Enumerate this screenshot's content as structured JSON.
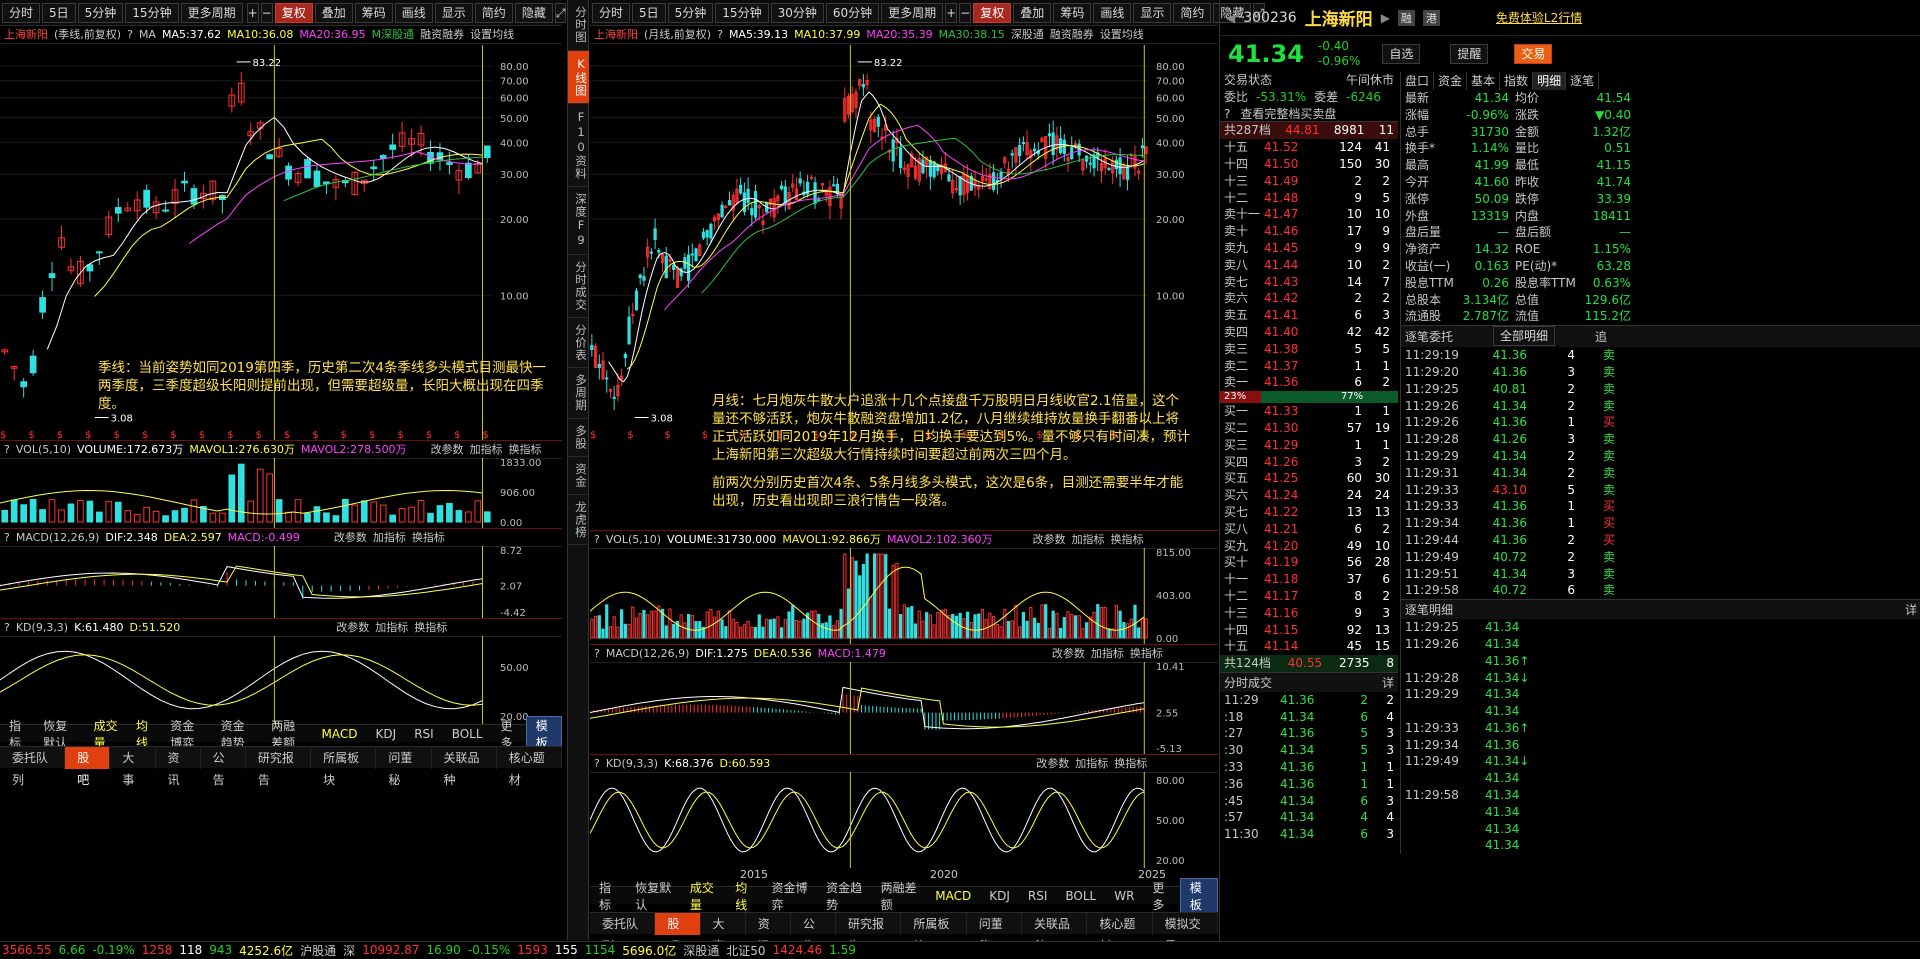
{
  "left_toolbar": {
    "periods": [
      "分时",
      "5日",
      "5分钟",
      "15分钟",
      "更多周期"
    ],
    "adj": "复权",
    "overlay": "叠加",
    "chips": "筹码",
    "draw": "画线",
    "display": "显示",
    "simple": "简约",
    "hide": "隐藏"
  },
  "right_toolbar": {
    "periods": [
      "分时",
      "5日",
      "5分钟",
      "15分钟",
      "30分钟",
      "60分钟",
      "更多周期"
    ],
    "adj": "复权",
    "overlay": "叠加",
    "chips": "筹码",
    "draw": "画线",
    "display": "显示",
    "simple": "简约",
    "hide": "隐藏"
  },
  "left_chart": {
    "header": {
      "name": "上海新阳",
      "mode": "(季线,前复权)",
      "ma_label": "MA",
      "ma5": "MA5:37.62",
      "ma10": "MA10:36.08",
      "ma20": "MA20:36.95",
      "ma30": "M深股通",
      "margin": "融资融券",
      "set": "设置均线"
    },
    "yticks": [
      "80.00",
      "70.00",
      "60.00",
      "50.00",
      "40.00",
      "30.00",
      "20.00",
      "10.00"
    ],
    "high_label": "83.22",
    "low_label": "3.08",
    "note": "季线：当前姿势如同2019第四季，历史第二次4条季线多头模式目测最快一两季度，三季度超级长阳则提前出现，但需要超级量，长阳大概出现在四季度。",
    "vol_header": {
      "name": "VOL(5,10)",
      "v": "VOLUME:172.673万",
      "m1": "MAVOL1:276.630万",
      "m2": "MAVOL2:278.500万",
      "edit": "改参数",
      "add": "加指标",
      "swap": "换指标"
    },
    "vol_ticks": [
      "1833.00",
      "906.00",
      "0.00"
    ],
    "macd_header": {
      "name": "MACD(12,26,9)",
      "dif": "DIF:2.348",
      "dea": "DEA:2.597",
      "macd": "MACD:-0.499",
      "edit": "改参数",
      "add": "加指标",
      "swap": "换指标"
    },
    "macd_ticks": [
      "8.72",
      "2.07",
      "-4.42"
    ],
    "kd_header": {
      "name": "KD(9,3,3)",
      "k": "K:61.480",
      "d": "D:51.520",
      "edit": "改参数",
      "add": "加指标",
      "swap": "换指标"
    },
    "kd_ticks": [
      "50.00",
      "20.00"
    ],
    "bottom_tabs": [
      "指标",
      "恢复默认",
      "成交量",
      "均线",
      "资金博弈",
      "资金趋势",
      "两融差额",
      "MACD",
      "KDJ",
      "RSI",
      "BOLL",
      "更多",
      "模板"
    ]
  },
  "vtabs": [
    "分时图",
    "K线图",
    "F10资料",
    "深度F9",
    "分时成交",
    "分价表",
    "多周期",
    "多股",
    "资金",
    "龙虎榜"
  ],
  "right_chart": {
    "header": {
      "name": "上海新阳",
      "mode": "(月线,前复权)",
      "ma5": "MA5:39.13",
      "ma10": "MA10:37.99",
      "ma20": "MA20:35.39",
      "ma30": "MA30:38.15",
      "hk": "深股通",
      "margin": "融资融券",
      "set": "设置均线"
    },
    "yticks": [
      "80.00",
      "70.00",
      "60.00",
      "50.00",
      "40.00",
      "30.00",
      "20.00",
      "10.00"
    ],
    "high_label": "83.22",
    "low_label": "3.08",
    "note1": "月线：七月炮灰牛散大户追涨十几个点接盘千万股明日月线收官2.1倍量，这个量还不够活跃，炮灰牛散融资盘增加1.2亿，八月继续维持放量换手翻番以上将正式活跃如同2019年12月换手，日均换手要达到5%。量不够只有时间凑，预计上海新阳第三次超级大行情持续时间要超过前两次三四个月。",
    "note2": "前两次分别历史首次4条、5条月线多头模式，这次是6条，目测还需要半年才能出现，历史看出现即三浪行情告一段落。",
    "vol_header": {
      "name": "VOL(5,10)",
      "v": "VOLUME:31730.000",
      "m1": "MAVOL1:92.866万",
      "m2": "MAVOL2:102.360万",
      "edit": "改参数",
      "add": "加指标",
      "swap": "换指标"
    },
    "vol_ticks": [
      "815.00",
      "403.00",
      "0.00"
    ],
    "macd_header": {
      "name": "MACD(12,26,9)",
      "dif": "DIF:1.275",
      "dea": "DEA:0.536",
      "macd": "MACD:1.479",
      "edit": "改参数",
      "add": "加指标",
      "swap": "换指标"
    },
    "macd_ticks": [
      "10.41",
      "2.55",
      "-5.13"
    ],
    "kd_header": {
      "name": "KD(9,3,3)",
      "k": "K:68.376",
      "d": "D:60.593",
      "edit": "改参数",
      "add": "加指标",
      "swap": "换指标"
    },
    "kd_ticks": [
      "80.00",
      "50.00",
      "20.00"
    ],
    "xlabels": [
      "2015",
      "2020",
      "2025"
    ],
    "bottom_tabs": [
      "指标",
      "恢复默认",
      "成交量",
      "均线",
      "资金博弈",
      "资金趋势",
      "两融差额",
      "MACD",
      "KDJ",
      "RSI",
      "BOLL",
      "WR",
      "更多",
      "模板"
    ]
  },
  "bottom_left": [
    "委托队列",
    "股吧",
    "大事",
    "资讯",
    "公告",
    "研究报告",
    "所属板块",
    "问董秘",
    "关联品种",
    "核心题材"
  ],
  "bottom_right": [
    "委托队列",
    "股吧",
    "大事",
    "资讯",
    "公告",
    "研究报告",
    "所属板块",
    "问董秘",
    "关联品种",
    "核心题材",
    "模拟交易"
  ],
  "status": {
    "sh_idx": "3566.55",
    "sh_chg": "6.66",
    "sh_pct": "-0.19%",
    "up": "1258",
    "flat": "118",
    "down": "943",
    "amt": "4252.6亿",
    "hgt": "沪股通",
    "sz_label": "深",
    "sz_idx": "10992.87",
    "sz_chg": "16.90",
    "sz_pct": "-0.15%",
    "sz_up": "1593",
    "sz_flat": "155",
    "sz_down": "1154",
    "sz_amt": "5696.0亿",
    "sgt": "深股通",
    "bz_label": "北证50",
    "bz_idx": "1424.46",
    "bz_chg": "1.59"
  },
  "quote": {
    "code": "300236",
    "name": "上海新阳",
    "free": "免费体验L2行情",
    "price": "41.34",
    "chg": "-0.40",
    "pct": "-0.96%",
    "buttons": [
      "自选",
      "提醒",
      "交易"
    ],
    "state_label": "交易状态",
    "state": "午间休市",
    "wb_label": "委比",
    "wb": "-53.31%",
    "wc_label": "委差",
    "wc": "-6246",
    "full_book": "查看完整档买卖盘",
    "ask_total": {
      "label": "共287档",
      "price": "44.81",
      "vol": "8981",
      "n": "11"
    },
    "asks": [
      {
        "l": "十五",
        "p": "41.52",
        "v": "124",
        "n": "41"
      },
      {
        "l": "十四",
        "p": "41.50",
        "v": "150",
        "n": "30"
      },
      {
        "l": "十三",
        "p": "41.49",
        "v": "2",
        "n": "2"
      },
      {
        "l": "十二",
        "p": "41.48",
        "v": "9",
        "n": "5"
      },
      {
        "l": "卖十一",
        "p": "41.47",
        "v": "10",
        "n": "10"
      },
      {
        "l": "卖十",
        "p": "41.46",
        "v": "17",
        "n": "9"
      },
      {
        "l": "卖九",
        "p": "41.45",
        "v": "9",
        "n": "9"
      },
      {
        "l": "卖八",
        "p": "41.44",
        "v": "10",
        "n": "2"
      },
      {
        "l": "卖七",
        "p": "41.43",
        "v": "14",
        "n": "7"
      },
      {
        "l": "卖六",
        "p": "41.42",
        "v": "2",
        "n": "2"
      },
      {
        "l": "卖五",
        "p": "41.41",
        "v": "6",
        "n": "3"
      },
      {
        "l": "卖四",
        "p": "41.40",
        "v": "42",
        "n": "42"
      },
      {
        "l": "卖三",
        "p": "41.38",
        "v": "5",
        "n": "5"
      },
      {
        "l": "卖二",
        "p": "41.37",
        "v": "1",
        "n": "1"
      },
      {
        "l": "卖一",
        "p": "41.36",
        "v": "6",
        "n": "2"
      }
    ],
    "ratio_sell": "23%",
    "ratio_buy": "77%",
    "bids": [
      {
        "l": "买一",
        "p": "41.33",
        "v": "1",
        "n": "1"
      },
      {
        "l": "买二",
        "p": "41.30",
        "v": "57",
        "n": "19"
      },
      {
        "l": "买三",
        "p": "41.29",
        "v": "1",
        "n": "1"
      },
      {
        "l": "买四",
        "p": "41.26",
        "v": "3",
        "n": "2"
      },
      {
        "l": "买五",
        "p": "41.25",
        "v": "60",
        "n": "30"
      },
      {
        "l": "买六",
        "p": "41.24",
        "v": "24",
        "n": "24"
      },
      {
        "l": "买七",
        "p": "41.22",
        "v": "13",
        "n": "13"
      },
      {
        "l": "买八",
        "p": "41.21",
        "v": "6",
        "n": "2"
      },
      {
        "l": "买九",
        "p": "41.20",
        "v": "49",
        "n": "10"
      },
      {
        "l": "买十",
        "p": "41.19",
        "v": "56",
        "n": "28"
      },
      {
        "l": "十一",
        "p": "41.18",
        "v": "37",
        "n": "6"
      },
      {
        "l": "十二",
        "p": "41.17",
        "v": "8",
        "n": "2"
      },
      {
        "l": "十三",
        "p": "41.16",
        "v": "9",
        "n": "3"
      },
      {
        "l": "十四",
        "p": "41.15",
        "v": "92",
        "n": "13"
      },
      {
        "l": "十五",
        "p": "41.14",
        "v": "45",
        "n": "15"
      }
    ],
    "bid_total": {
      "label": "共124档",
      "price": "40.55",
      "vol": "2735",
      "n": "8"
    },
    "ticks_title": "分时成交",
    "ticks_detail": "详",
    "ticks": [
      {
        "t": "11:29",
        "p": "41.36",
        "v": "2",
        "n": "2"
      },
      {
        "t": ":18",
        "p": "41.34",
        "v": "6",
        "n": "4"
      },
      {
        "t": ":27",
        "p": "41.36",
        "v": "5",
        "n": "3"
      },
      {
        "t": ":30",
        "p": "41.34",
        "v": "5",
        "n": "3"
      },
      {
        "t": ":33",
        "p": "41.36",
        "v": "1",
        "n": "1"
      },
      {
        "t": ":36",
        "p": "41.36",
        "v": "1",
        "n": "1"
      },
      {
        "t": ":45",
        "p": "41.34",
        "v": "6",
        "n": "3"
      },
      {
        "t": ":57",
        "p": "41.34",
        "v": "4",
        "n": "4"
      },
      {
        "t": "11:30",
        "p": "41.34",
        "v": "6",
        "n": "3"
      }
    ]
  },
  "tabs_right": [
    "盘口",
    "资金",
    "基本",
    "指数",
    "明细",
    "逐笔"
  ],
  "stats": [
    {
      "a": "最新",
      "av": "41.34",
      "b": "均价",
      "bv": "41.54"
    },
    {
      "a": "涨幅",
      "av": "-0.96%",
      "b": "涨跌",
      "bv": "▼0.40"
    },
    {
      "a": "总手",
      "av": "31730",
      "b": "金额",
      "bv": "1.32亿"
    },
    {
      "a": "换手*",
      "av": "1.14%",
      "b": "量比",
      "bv": "0.51"
    },
    {
      "a": "最高",
      "av": "41.99",
      "b": "最低",
      "bv": "41.15"
    },
    {
      "a": "今开",
      "av": "41.60",
      "b": "昨收",
      "bv": "41.74"
    },
    {
      "a": "涨停",
      "av": "50.09",
      "b": "跌停",
      "bv": "33.39"
    },
    {
      "a": "外盘",
      "av": "13319",
      "b": "内盘",
      "bv": "18411"
    },
    {
      "a": "盘后量",
      "av": "—",
      "b": "盘后额",
      "bv": "—"
    },
    {
      "a": "净资产",
      "av": "14.32",
      "b": "ROE",
      "bv": "1.15%"
    },
    {
      "a": "收益(一)",
      "av": "0.163",
      "b": "PE(动)*",
      "bv": "63.28"
    },
    {
      "a": "股息TTM",
      "av": "0.26",
      "b": "股息率TTM",
      "bv": "0.63%"
    },
    {
      "a": "总股本",
      "av": "3.134亿",
      "b": "总值",
      "bv": "129.6亿"
    },
    {
      "a": "流通股",
      "av": "2.787亿",
      "b": "流值",
      "bv": "115.2亿"
    }
  ],
  "zbwt_title": "逐笔委托",
  "zbwt_filter": "全部明细",
  "zbwt_back": "追",
  "zbwt": [
    {
      "t": "11:29:19",
      "p": "41.36",
      "v": "4",
      "s": "卖"
    },
    {
      "t": "11:29:20",
      "p": "41.36",
      "v": "3",
      "s": "卖"
    },
    {
      "t": "11:29:25",
      "p": "40.81",
      "v": "2",
      "s": "卖"
    },
    {
      "t": "11:29:26",
      "p": "41.34",
      "v": "2",
      "s": "卖"
    },
    {
      "t": "11:29:26",
      "p": "41.36",
      "v": "1",
      "s": "买"
    },
    {
      "t": "11:29:28",
      "p": "41.26",
      "v": "3",
      "s": "卖"
    },
    {
      "t": "11:29:29",
      "p": "41.34",
      "v": "2",
      "s": "卖"
    },
    {
      "t": "11:29:31",
      "p": "41.34",
      "v": "2",
      "s": "卖"
    },
    {
      "t": "11:29:33",
      "p": "43.10",
      "v": "5",
      "s": "卖"
    },
    {
      "t": "11:29:33",
      "p": "41.36",
      "v": "1",
      "s": "买"
    },
    {
      "t": "11:29:34",
      "p": "41.36",
      "v": "1",
      "s": "买"
    },
    {
      "t": "11:29:44",
      "p": "41.36",
      "v": "2",
      "s": "买"
    },
    {
      "t": "11:29:49",
      "p": "40.72",
      "v": "2",
      "s": "卖"
    },
    {
      "t": "11:29:51",
      "p": "41.34",
      "v": "3",
      "s": "卖"
    },
    {
      "t": "11:29:58",
      "p": "40.72",
      "v": "6",
      "s": "卖"
    }
  ],
  "zbmx_title": "逐笔明细",
  "zbmx_detail": "详",
  "zbmx": [
    {
      "t": "11:29:25",
      "p": "41.34"
    },
    {
      "t": "11:29:26",
      "p": "41.34"
    },
    {
      "t": "",
      "p": "41.36↑"
    },
    {
      "t": "11:29:28",
      "p": "41.34↓"
    },
    {
      "t": "11:29:29",
      "p": "41.34"
    },
    {
      "t": "",
      "p": "41.34"
    },
    {
      "t": "11:29:33",
      "p": "41.36↑"
    },
    {
      "t": "11:29:34",
      "p": "41.36"
    },
    {
      "t": "11:29:49",
      "p": "41.34↓"
    },
    {
      "t": "",
      "p": "41.34"
    },
    {
      "t": "11:29:58",
      "p": "41.34"
    },
    {
      "t": "",
      "p": "41.34"
    },
    {
      "t": "",
      "p": "41.34"
    },
    {
      "t": "",
      "p": "41.34"
    }
  ],
  "colors": {
    "up": "#ff3030",
    "down": "#30e0e0",
    "ma5": "#ffffff",
    "ma10": "#ffff40",
    "ma20": "#ff40ff",
    "ma30": "#30c040",
    "accent": "#e04010"
  }
}
